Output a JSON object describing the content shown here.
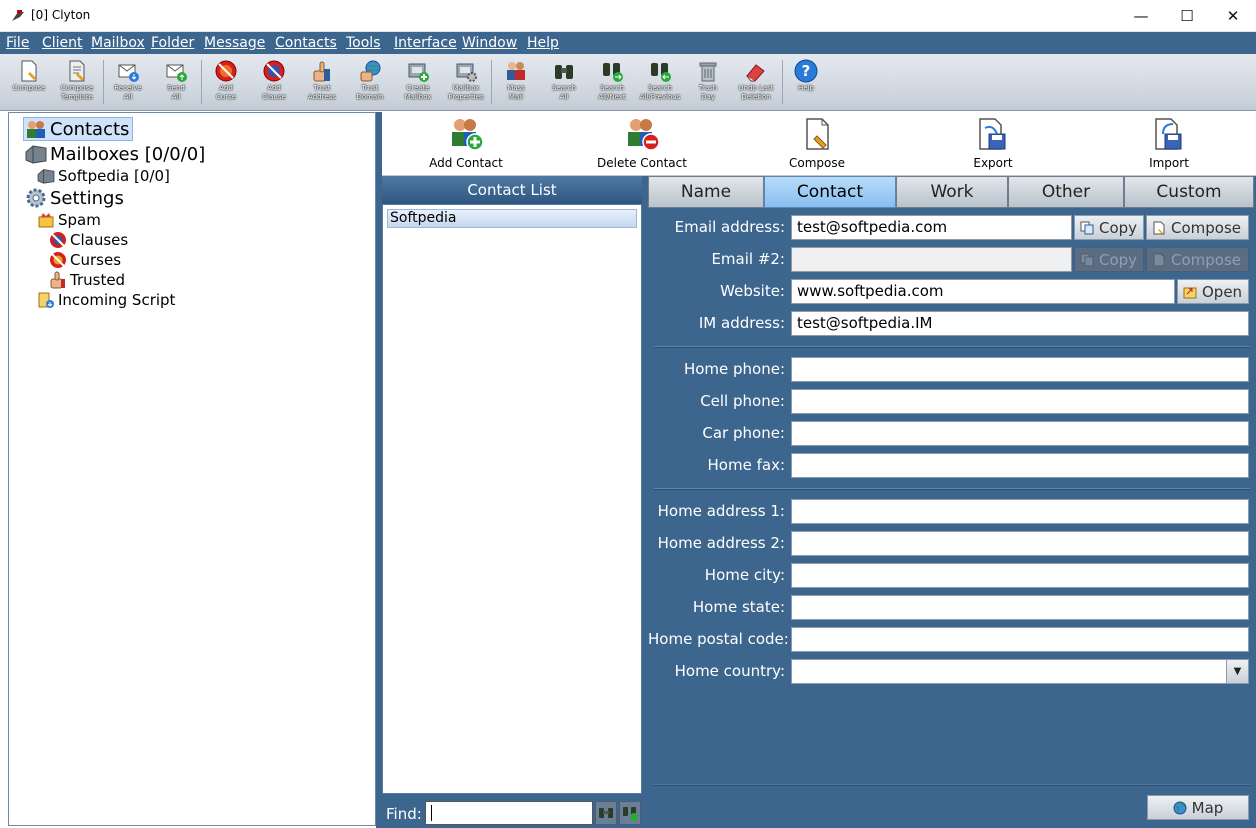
{
  "window": {
    "title": "[0] Clyton",
    "minimize": "—",
    "maximize": "☐",
    "close": "✕"
  },
  "menu": [
    "File",
    "Client",
    "Mailbox",
    "Folder",
    "Message",
    "Contacts",
    "Tools",
    "Interface",
    "Window",
    "Help"
  ],
  "toolbar": [
    {
      "icon": "compose-icon",
      "label": "Compose"
    },
    {
      "icon": "compose-template-icon",
      "label": "Compose\nTemplate"
    },
    {
      "icon": "receive-all-icon",
      "label": "Receive\nAll"
    },
    {
      "icon": "send-all-icon",
      "label": "Send\nAll"
    },
    {
      "icon": "add-curse-icon",
      "label": "Add\nCurse"
    },
    {
      "icon": "add-clause-icon",
      "label": "Add\nClause"
    },
    {
      "icon": "trust-address-icon",
      "label": "Trust\nAddress"
    },
    {
      "icon": "trust-domain-icon",
      "label": "Trust\nDomain"
    },
    {
      "icon": "create-mailbox-icon",
      "label": "Create\nMailbox"
    },
    {
      "icon": "mailbox-properties-icon",
      "label": "Mailbox\nProperties"
    },
    {
      "icon": "mass-mail-icon",
      "label": "Mass\nMail"
    },
    {
      "icon": "search-all-icon",
      "label": "Search\nAll"
    },
    {
      "icon": "search-next-icon",
      "label": "Search\nAll/Next"
    },
    {
      "icon": "search-previous-icon",
      "label": "Search\nAll/Previous"
    },
    {
      "icon": "trash-icon",
      "label": "Trash\nDay"
    },
    {
      "icon": "eraser-icon",
      "label": "Undo Last\nDeletion"
    },
    {
      "icon": "help-icon",
      "label": "Help"
    }
  ],
  "tree": {
    "contacts": "Contacts",
    "mailboxes": "Mailboxes [0/0/0]",
    "softpedia": "Softpedia [0/0]",
    "settings": "Settings",
    "spam": "Spam",
    "clauses": "Clauses",
    "curses": "Curses",
    "trusted": "Trusted",
    "incoming_script": "Incoming Script"
  },
  "actions": {
    "add_contact": "Add Contact",
    "delete_contact": "Delete Contact",
    "compose": "Compose",
    "export": "Export",
    "import": "Import"
  },
  "contact_list": {
    "header": "Contact List",
    "items": [
      "Softpedia"
    ],
    "find_label": "Find:"
  },
  "tabs": [
    "Name",
    "Contact",
    "Work",
    "Other",
    "Custom"
  ],
  "active_tab": "Contact",
  "fields": {
    "email_label": "Email address:",
    "email_value": "test@softpedia.com",
    "email2_label": "Email #2:",
    "email2_value": "",
    "website_label": "Website:",
    "website_value": "www.softpedia.com",
    "im_label": "IM address:",
    "im_value": "test@softpedia.IM",
    "home_phone_label": "Home phone:",
    "cell_phone_label": "Cell phone:",
    "car_phone_label": "Car phone:",
    "home_fax_label": "Home fax:",
    "home_address1_label": "Home address 1:",
    "home_address2_label": "Home address 2:",
    "home_city_label": "Home city:",
    "home_state_label": "Home state:",
    "home_postal_label": "Home postal code:",
    "home_country_label": "Home country:"
  },
  "buttons": {
    "copy": "Copy",
    "compose": "Compose",
    "open": "Open",
    "map": "Map"
  },
  "colors": {
    "panel_blue": "#3d668f",
    "tab_active": "#9ccbf6",
    "selection": "#c4d7f0"
  }
}
